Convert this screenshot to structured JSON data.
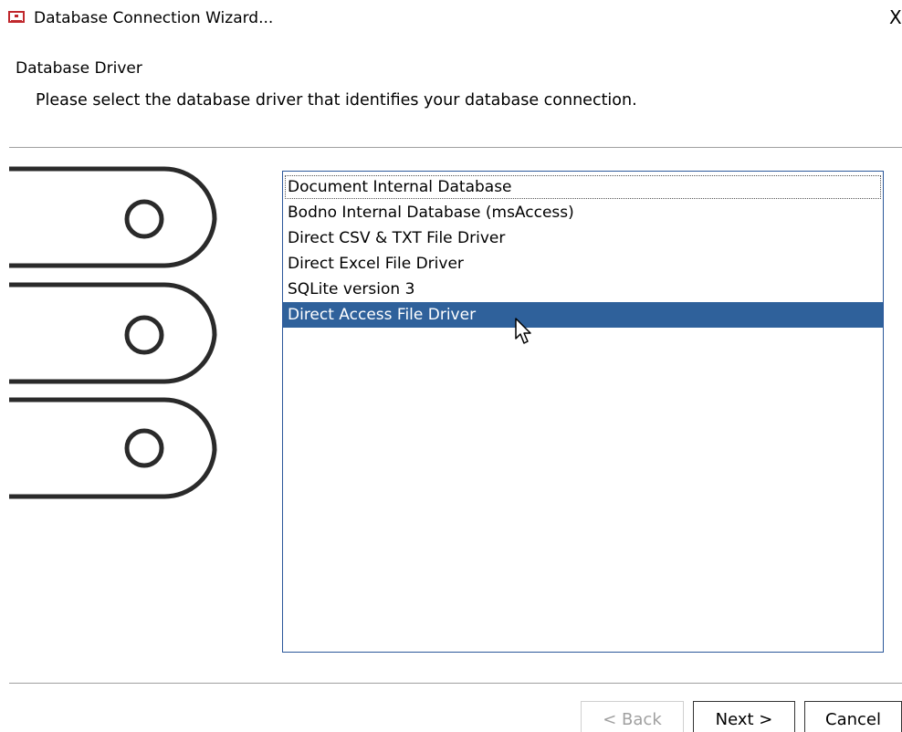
{
  "window": {
    "title": "Database Connection Wizard...",
    "close_glyph": "X"
  },
  "header": {
    "section_title": "Database Driver",
    "description": "Please select the database driver that identifies your database connection."
  },
  "drivers": [
    {
      "label": "Document Internal Database"
    },
    {
      "label": "Bodno Internal Database (msAccess)"
    },
    {
      "label": "Direct CSV & TXT File Driver"
    },
    {
      "label": "Direct Excel File Driver"
    },
    {
      "label": "SQLite version 3"
    },
    {
      "label": "Direct Access File Driver"
    }
  ],
  "buttons": {
    "back": "< Back",
    "next": "Next >",
    "cancel": "Cancel"
  },
  "colors": {
    "selection": "#2f619b",
    "list_border": "#2b579a",
    "app_icon": "#c0282d"
  }
}
